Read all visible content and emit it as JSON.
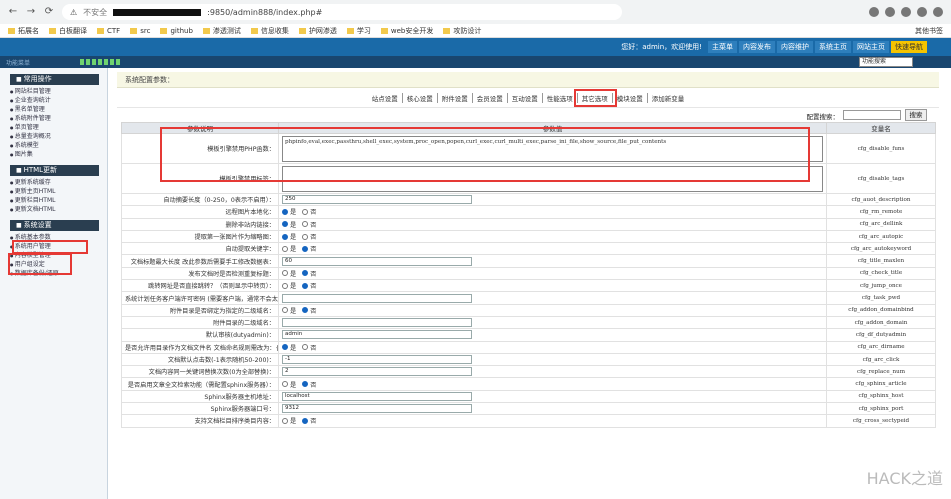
{
  "browser": {
    "insecure_label": "不安全",
    "url_tail": ":9850/admin888/index.php#",
    "bookmarks": [
      "拓展名",
      "白板翻译",
      "CTF",
      "src",
      "github",
      "渗透测试",
      "信息收集",
      "护网渗透",
      "学习",
      "web安全开发",
      "攻防设计"
    ],
    "bookmarks_right": "其他书签"
  },
  "header": {
    "greeting": "您好：admin，欢迎使用!",
    "links": [
      "主菜单",
      "内容发布",
      "内容维护",
      "系统主页",
      "网站主页",
      "快速导航"
    ],
    "section_label": "功能菜单",
    "func_select": "功能搜索"
  },
  "sidebar": {
    "sections": [
      {
        "title": "常用操作",
        "items": [
          "网站栏目管理",
          "企业查询统计",
          "黑名单管理",
          "系统附件管理",
          "单页管理",
          "总量查询概况",
          "系统模型",
          "图片集"
        ]
      },
      {
        "title": "HTML更新",
        "items": [
          "更新系统缓存",
          "更新主页HTML",
          "更新栏目HTML",
          "更新文档HTML"
        ]
      },
      {
        "title": "系统设置",
        "items": [
          "系统基本参数",
          "系统用户管理",
          "内容模型管理",
          "用户组设定",
          "数据库备份/还原"
        ]
      }
    ]
  },
  "main": {
    "crumb": "系统配置参数：",
    "tabs": [
      "站点设置",
      "核心设置",
      "附件设置",
      "会员设置",
      "互动设置",
      "性能选项",
      "其它选项",
      "模块设置",
      "添加新变量"
    ],
    "search_label": "配置搜索：",
    "search_button": "搜索",
    "columns": [
      "参数说明",
      "参数值",
      "变量名"
    ],
    "rows": [
      {
        "label": "模板引擎禁用PHP函数：",
        "type": "textarea",
        "value": "phpinfo,eval,exec,passthru,shell_exec,system,proc_open,popen,curl_exec,curl_multi_exec,parse_ini_file,show_source,file_put_contents",
        "var": "cfg_disable_funs"
      },
      {
        "label": "模板引擎禁用标签：",
        "type": "textarea",
        "value": "",
        "var": "cfg_disable_tags"
      },
      {
        "label": "自动摘要长度（0-250，0表示不启用）：",
        "type": "input",
        "value": "250",
        "var": "cfg_auot_description"
      },
      {
        "label": "远程图片本地化：",
        "type": "radio",
        "on": "是",
        "var": "cfg_rm_remote"
      },
      {
        "label": "删除非站内链接：",
        "type": "radio",
        "on": "是",
        "var": "cfg_arc_dellink"
      },
      {
        "label": "提取第一张图片作为缩略图：",
        "type": "radio",
        "on": "是",
        "var": "cfg_arc_autopic"
      },
      {
        "label": "自动提取关键字：",
        "type": "radio",
        "on": "否",
        "var": "cfg_arc_autokeyword"
      },
      {
        "label": "文档标题最大长度 改此参数后需要手工修改数据表：",
        "type": "input",
        "value": "60",
        "var": "cfg_title_maxlen"
      },
      {
        "label": "发布文档时是否检测重复标题：",
        "type": "radio",
        "on": "否",
        "var": "cfg_check_title"
      },
      {
        "label": "跳转网址是否直接跳转？（否则显示中转页）：",
        "type": "radio",
        "on": "否",
        "var": "cfg_jump_once"
      },
      {
        "label": "系统计划任务客户端许可密码 (需要客户端，通常不会太重要)：",
        "type": "input",
        "value": "",
        "var": "cfg_task_pwd"
      },
      {
        "label": "附件目录是否绑定为指定的二级域名：",
        "type": "radio",
        "on": "否",
        "var": "cfg_addon_domainbind"
      },
      {
        "label": "附件目录的二级域名：",
        "type": "input",
        "value": "",
        "var": "cfg_addon_domain"
      },
      {
        "label": "默认审核(dutyadmin)：",
        "type": "input",
        "value": "admin",
        "var": "cfg_df_dutyadmin"
      },
      {
        "label": "是否允许用目录作为文档文件名 文档命名规则需改为：{typedir}/{aid}/index.html：",
        "type": "radio",
        "on": "是",
        "var": "cfg_arc_dirname"
      },
      {
        "label": "文档默认点击数(-1表示随机50-200)：",
        "type": "input",
        "value": "-1",
        "var": "cfg_arc_click"
      },
      {
        "label": "文档内容同一关键词替换次数(0为全部替换)：",
        "type": "input",
        "value": "2",
        "var": "cfg_replace_num"
      },
      {
        "label": "是否启用文章全文检索功能（需配置sphinx服务器）：",
        "type": "radio",
        "on": "否",
        "var": "cfg_sphinx_article"
      },
      {
        "label": "Sphinx服务器主机地址：",
        "type": "input",
        "value": "localhost",
        "var": "cfg_sphinx_host"
      },
      {
        "label": "Sphinx服务器端口号：",
        "type": "input",
        "value": "9312",
        "var": "cfg_sphinx_port"
      },
      {
        "label": "支持文档栏目排序类目内容：",
        "type": "radio",
        "on": "否",
        "var": "cfg_cross_sectypeid"
      }
    ],
    "radio_yes": "是",
    "radio_no": "否"
  },
  "watermark": "HACK之道"
}
